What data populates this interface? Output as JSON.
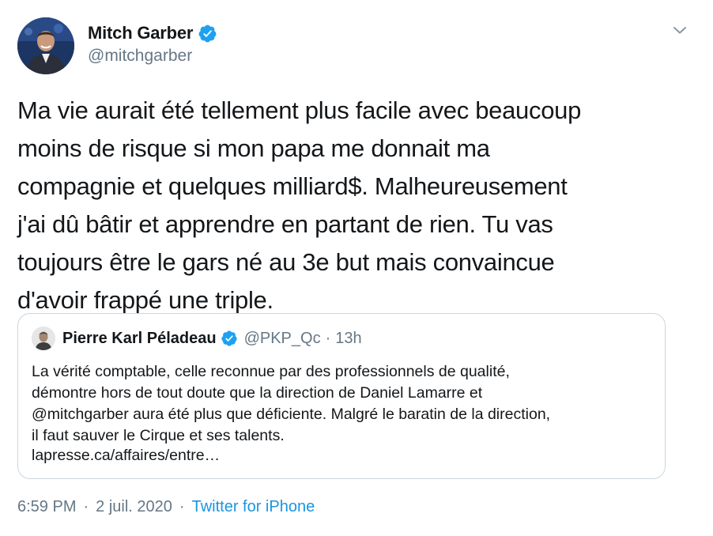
{
  "author": {
    "name": "Mitch Garber",
    "handle": "@mitchgarber",
    "verified": true
  },
  "tweet": {
    "text": "Ma vie aurait été tellement plus facile avec beaucoup\nmoins de risque si mon papa me donnait ma\ncompagnie et quelques milliard$. Malheureusement\nj'ai dû bâtir et apprendre en partant de rien. Tu vas\ntoujours être le gars né au 3e but mais convaincue\nd'avoir frappé une triple."
  },
  "quoted_tweet": {
    "name": "Pierre Karl Péladeau",
    "verified": true,
    "handle": "@PKP_Qc",
    "separator": "·",
    "time": "13h",
    "text": "La vérité comptable, celle reconnue par des professionnels de qualité,\ndémontre hors de tout doute que la direction de Daniel Lamarre et\n@mitchgarber aura été plus que déficiente. Malgré le baratin de la direction,\nil faut sauver le Cirque et ses talents.",
    "link": "lapresse.ca/affaires/entre…"
  },
  "meta": {
    "time": "6:59 PM",
    "separator": "·",
    "date": "2 juil. 2020",
    "source": "Twitter for iPhone"
  },
  "colors": {
    "verified": "#1da1f2",
    "secondary_text": "#657786",
    "link": "#1b95e0",
    "border": "#ccd6dd"
  },
  "icons": {
    "verified": "verified-badge-icon",
    "more": "chevron-down-icon"
  }
}
